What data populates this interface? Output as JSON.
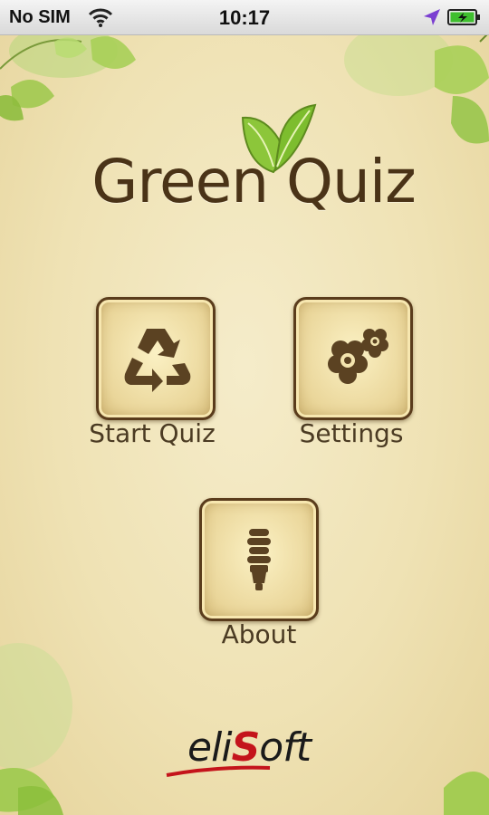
{
  "status_bar": {
    "carrier": "No SIM",
    "time": "10:17",
    "wifi_icon": "wifi-icon",
    "location_icon": "location-arrow-icon",
    "battery_icon": "battery-charging-icon"
  },
  "app": {
    "title": "Green Quiz",
    "sprout_icon": "leaf-sprout-icon"
  },
  "menu": [
    {
      "label": "Start Quiz",
      "icon": "recycle-icon"
    },
    {
      "label": "Settings",
      "icon": "flower-gears-icon"
    },
    {
      "label": "About",
      "icon": "lightbulb-icon"
    }
  ],
  "brand": {
    "prefix": "eli",
    "highlight": "S",
    "suffix": "oft"
  },
  "colors": {
    "background": "#efe2b4",
    "title_brown": "#4a3317",
    "leaf_green": "#8fc43a",
    "brand_red": "#c4141b"
  }
}
